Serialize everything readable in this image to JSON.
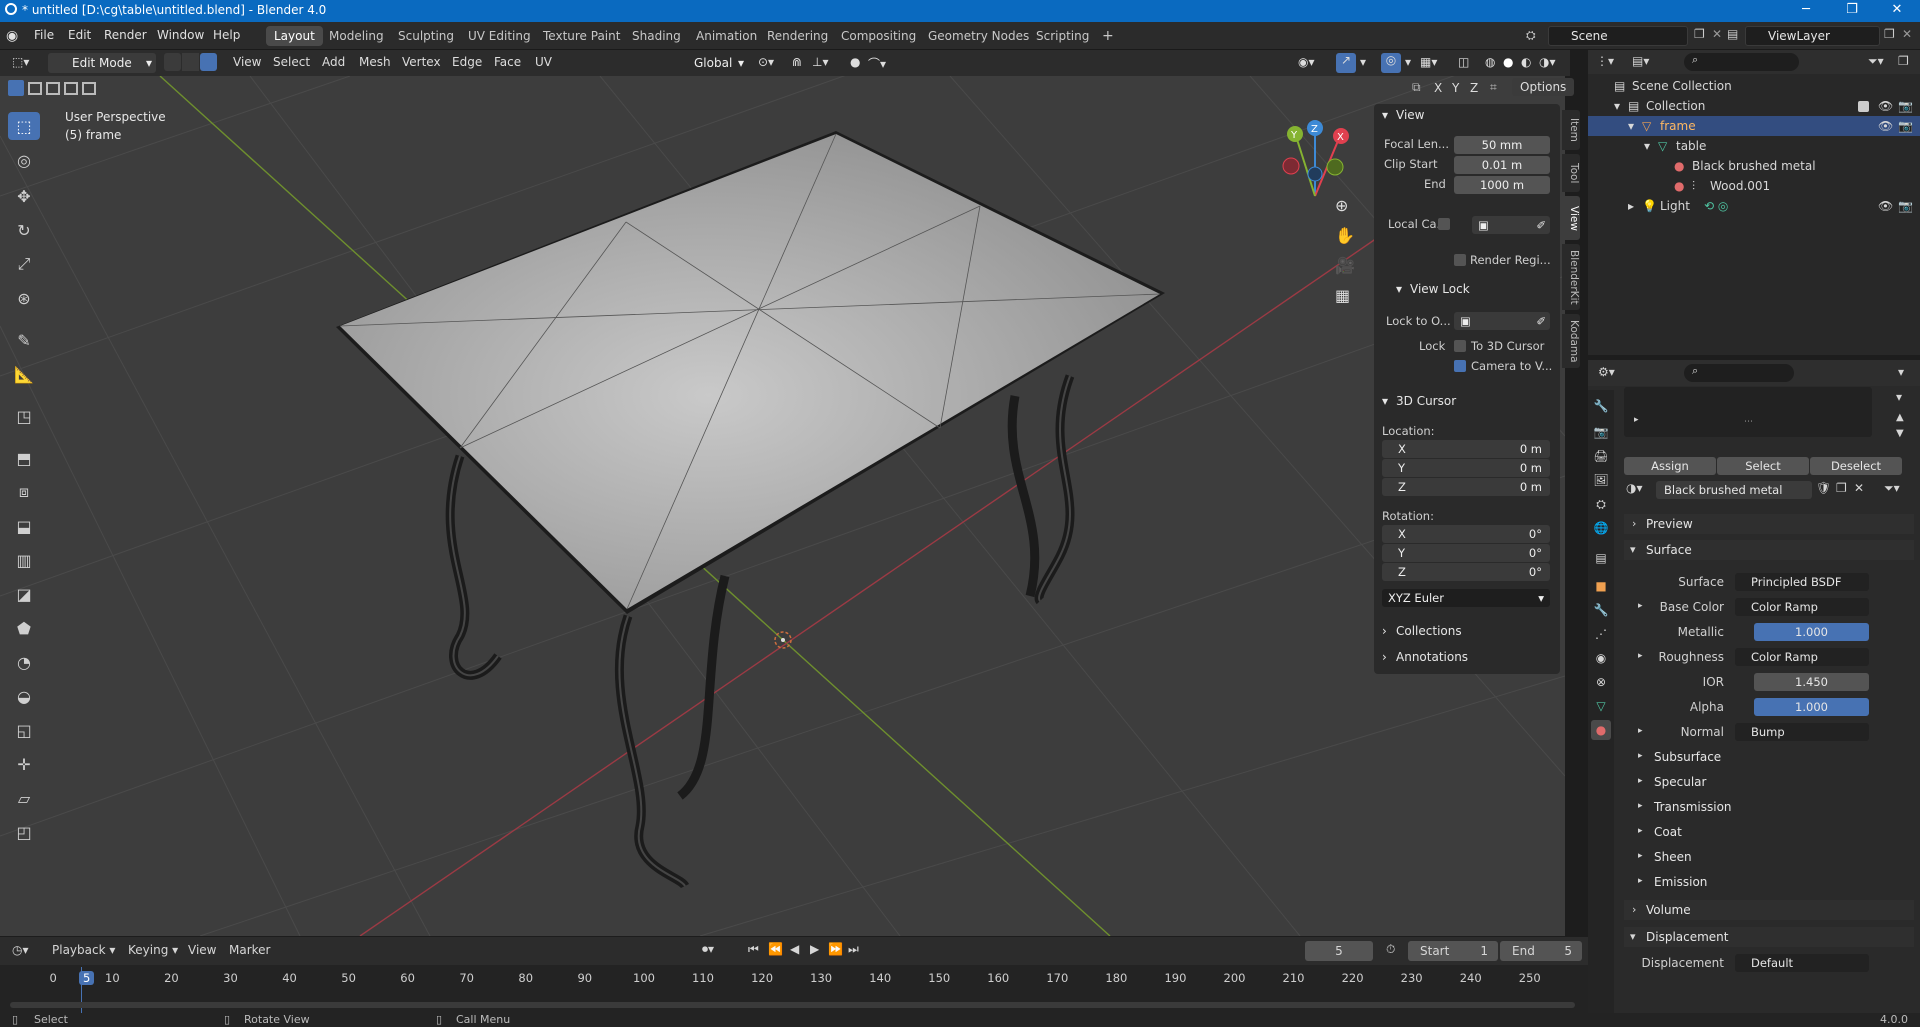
{
  "window": {
    "title": "* untitled [D:\\cg\\table\\untitled.blend] - Blender 4.0",
    "controls": [
      "─",
      "❐",
      "✕"
    ]
  },
  "menu": [
    "File",
    "Edit",
    "Render",
    "Window",
    "Help"
  ],
  "workspaces": [
    {
      "label": "Layout",
      "active": true
    },
    {
      "label": "Modeling"
    },
    {
      "label": "Sculpting"
    },
    {
      "label": "UV Editing"
    },
    {
      "label": "Texture Paint"
    },
    {
      "label": "Shading"
    },
    {
      "label": "Animation"
    },
    {
      "label": "Rendering"
    },
    {
      "label": "Compositing"
    },
    {
      "label": "Geometry Nodes"
    },
    {
      "label": "Scripting"
    }
  ],
  "add_workspace": "+",
  "scene": {
    "label": "Scene",
    "view_layer": "ViewLayer"
  },
  "viewport_header": {
    "mode": "Edit Mode",
    "menus": [
      "View",
      "Select",
      "Add",
      "Mesh",
      "Vertex",
      "Edge",
      "Face",
      "UV"
    ],
    "orientation": "Global",
    "options": "Options"
  },
  "viewport": {
    "perspective": "User Perspective",
    "object": "(5) frame",
    "gizmo": {
      "x": "X",
      "y": "Y",
      "z": "Z"
    },
    "xyz_toggles": [
      "X",
      "Y",
      "Z"
    ]
  },
  "npanel": {
    "tabs": [
      "Item",
      "Tool",
      "View",
      "BlenderKit",
      "Kodama"
    ],
    "active_tab": "View",
    "view_header": "View",
    "focal_label": "Focal Len...",
    "focal_value": "50 mm",
    "clip_start_label": "Clip Start",
    "clip_start_value": "0.01 m",
    "clip_end_label": "End",
    "clip_end_value": "1000 m",
    "local_camera_label": "Local Ca...",
    "render_region_label": "Render Regi...",
    "view_lock_header": "View Lock",
    "lock_to_label": "Lock to O...",
    "lock_label": "Lock",
    "to_3d_cursor": "To 3D Cursor",
    "camera_to_view": "Camera to V...",
    "cursor_header": "3D Cursor",
    "location_label": "Location:",
    "loc_x": "0 m",
    "loc_y": "0 m",
    "loc_z": "0 m",
    "rotation_label": "Rotation:",
    "rot_x": "0°",
    "rot_y": "0°",
    "rot_z": "0°",
    "axis_x": "X",
    "axis_y": "Y",
    "axis_z": "Z",
    "euler": "XYZ Euler",
    "collections": "Collections",
    "annotations": "Annotations"
  },
  "outliner": {
    "rows": [
      {
        "label": "Scene Collection",
        "indent": 1,
        "icon": "collection-icon"
      },
      {
        "label": "Collection",
        "indent": 2,
        "icon": "collection-icon"
      },
      {
        "label": "frame",
        "indent": 3,
        "icon": "mesh-object-icon",
        "selected": true
      },
      {
        "label": "table",
        "indent": 4,
        "icon": "mesh-data-icon"
      },
      {
        "label": "Black brushed metal",
        "indent": 5,
        "icon": "material-icon"
      },
      {
        "label": "Wood.001",
        "indent": 5,
        "icon": "material-icon"
      },
      {
        "label": "Light",
        "indent": 2,
        "icon": "light-icon"
      }
    ]
  },
  "properties": {
    "assign": "Assign",
    "select": "Select",
    "deselect": "Deselect",
    "material_name": "Black brushed metal",
    "preview": "Preview",
    "surface_header": "Surface",
    "surface_label": "Surface",
    "surface_value": "Principled BSDF",
    "base_color_label": "Base Color",
    "base_color_value": "Color Ramp",
    "metallic_label": "Metallic",
    "metallic_value": "1.000",
    "roughness_label": "Roughness",
    "roughness_value": "Color Ramp",
    "ior_label": "IOR",
    "ior_value": "1.450",
    "alpha_label": "Alpha",
    "alpha_value": "1.000",
    "normal_label": "Normal",
    "normal_value": "Bump",
    "subsections": [
      "Subsurface",
      "Specular",
      "Transmission",
      "Coat",
      "Sheen",
      "Emission"
    ],
    "volume": "Volume",
    "displacement_header": "Displacement",
    "displacement_label": "Displacement",
    "displacement_value": "Default"
  },
  "timeline": {
    "menus": [
      "Playback",
      "Keying",
      "View",
      "Marker"
    ],
    "current_frame": "5",
    "start_label": "Start",
    "start": "1",
    "end_label": "End",
    "end": "5",
    "ticks": [
      "0",
      "5",
      "10",
      "20",
      "30",
      "40",
      "50",
      "60",
      "70",
      "80",
      "90",
      "100",
      "110",
      "120",
      "130",
      "140",
      "150",
      "160",
      "170",
      "180",
      "190",
      "200",
      "210",
      "220",
      "230",
      "240",
      "250"
    ]
  },
  "statusbar": {
    "select": "Select",
    "rotate": "Rotate View",
    "call_menu": "Call Menu",
    "version": "4.0.0"
  },
  "colors": {
    "accent": "#4772b3",
    "titlebar": "#0a6ac0",
    "x_axis": "#e0404f",
    "y_axis": "#85b331",
    "z_axis": "#3d8ad6"
  }
}
